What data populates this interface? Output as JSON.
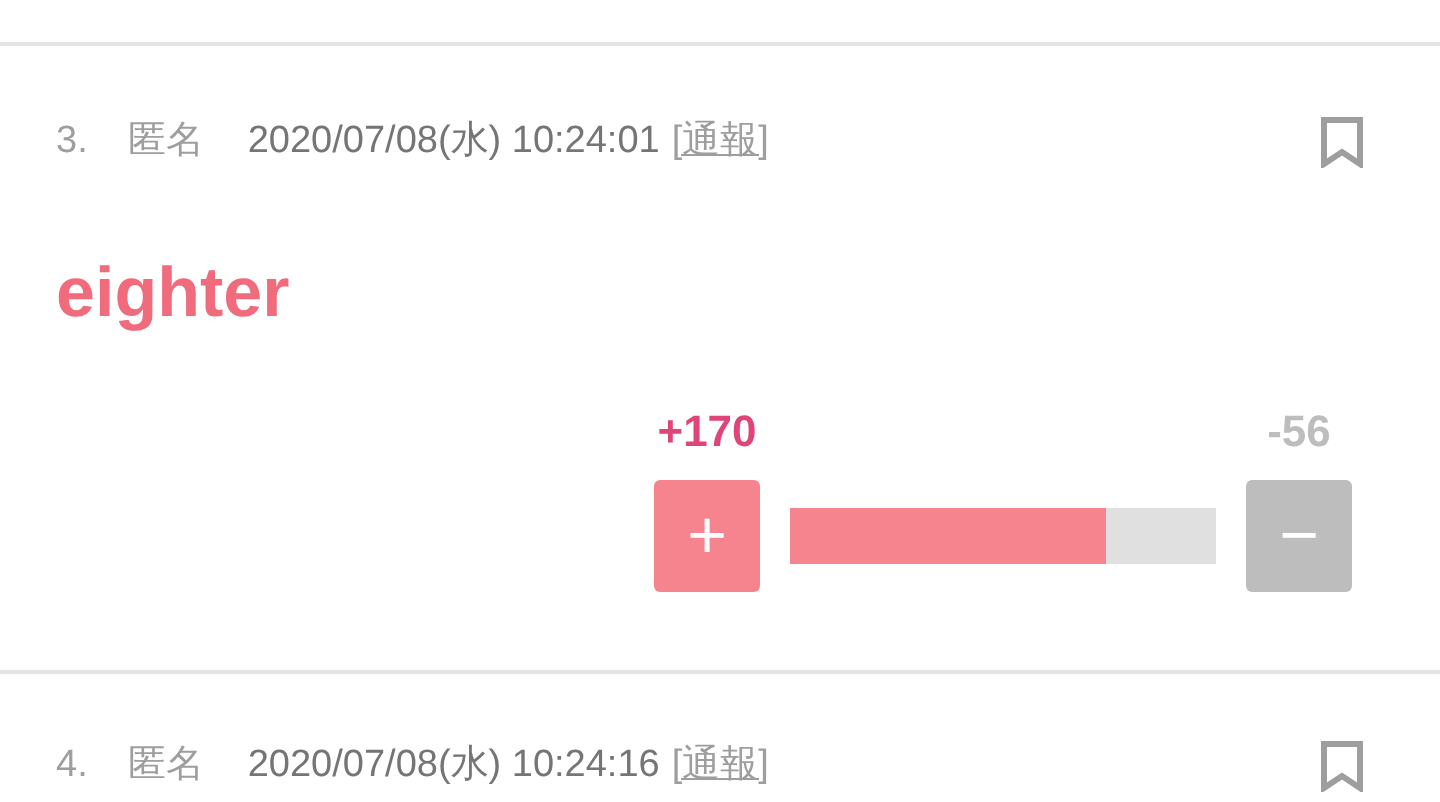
{
  "posts": [
    {
      "number": "3.",
      "author": "匿名",
      "date": "2020/07/08(水) 10:24:01",
      "report": "[通報]",
      "bookmarked": false,
      "body": "eighter",
      "votes": {
        "plus_label": "+",
        "plus": "+170",
        "minus_label": "−",
        "minus": "-56",
        "level": 0.74
      }
    },
    {
      "number": "4.",
      "author": "匿名",
      "date": "2020/07/08(水) 10:24:16",
      "report": "[通報]",
      "bookmarked": false
    }
  ]
}
